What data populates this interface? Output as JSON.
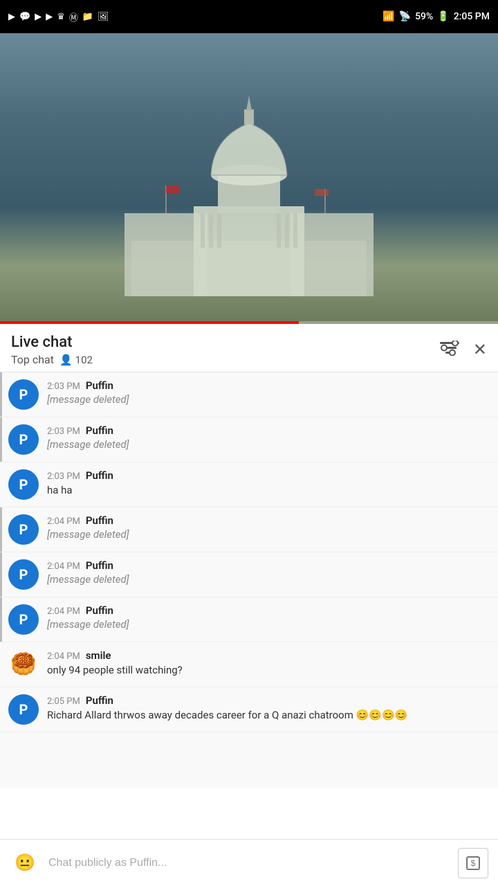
{
  "statusBar": {
    "battery": "59%",
    "time": "2:05 PM"
  },
  "header": {
    "title": "Live chat",
    "topChatLabel": "Top chat",
    "viewerCount": "102",
    "viewerIcon": "👤"
  },
  "messages": [
    {
      "id": 1,
      "time": "2:03 PM",
      "author": "Puffin",
      "text": "[message deleted]",
      "deleted": true,
      "avatarType": "blue",
      "avatarLetter": "P",
      "hasLeftBar": true
    },
    {
      "id": 2,
      "time": "2:03 PM",
      "author": "Puffin",
      "text": "[message deleted]",
      "deleted": true,
      "avatarType": "blue",
      "avatarLetter": "P",
      "hasLeftBar": true
    },
    {
      "id": 3,
      "time": "2:03 PM",
      "author": "Puffin",
      "text": "ha ha",
      "deleted": false,
      "avatarType": "blue",
      "avatarLetter": "P",
      "hasLeftBar": false
    },
    {
      "id": 4,
      "time": "2:04 PM",
      "author": "Puffin",
      "text": "[message deleted]",
      "deleted": true,
      "avatarType": "blue",
      "avatarLetter": "P",
      "hasLeftBar": true
    },
    {
      "id": 5,
      "time": "2:04 PM",
      "author": "Puffin",
      "text": "[message deleted]",
      "deleted": true,
      "avatarType": "blue",
      "avatarLetter": "P",
      "hasLeftBar": true
    },
    {
      "id": 6,
      "time": "2:04 PM",
      "author": "Puffin",
      "text": "[message deleted]",
      "deleted": true,
      "avatarType": "blue",
      "avatarLetter": "P",
      "hasLeftBar": true
    },
    {
      "id": 7,
      "time": "2:04 PM",
      "author": "smile",
      "text": "only 94 people still watching?",
      "deleted": false,
      "avatarType": "emoji",
      "avatarEmoji": "🥮",
      "hasLeftBar": false
    },
    {
      "id": 8,
      "time": "2:05 PM",
      "author": "Puffin",
      "text": "Richard Allard thrwos away decades career for a Q anazi chatroom 😊😊😊😊",
      "deleted": false,
      "avatarType": "blue",
      "avatarLetter": "P",
      "hasLeftBar": false
    }
  ],
  "inputBar": {
    "placeholder": "Chat publicly as Puffin...",
    "emojiIcon": "😐",
    "sendIcon": "💲"
  }
}
